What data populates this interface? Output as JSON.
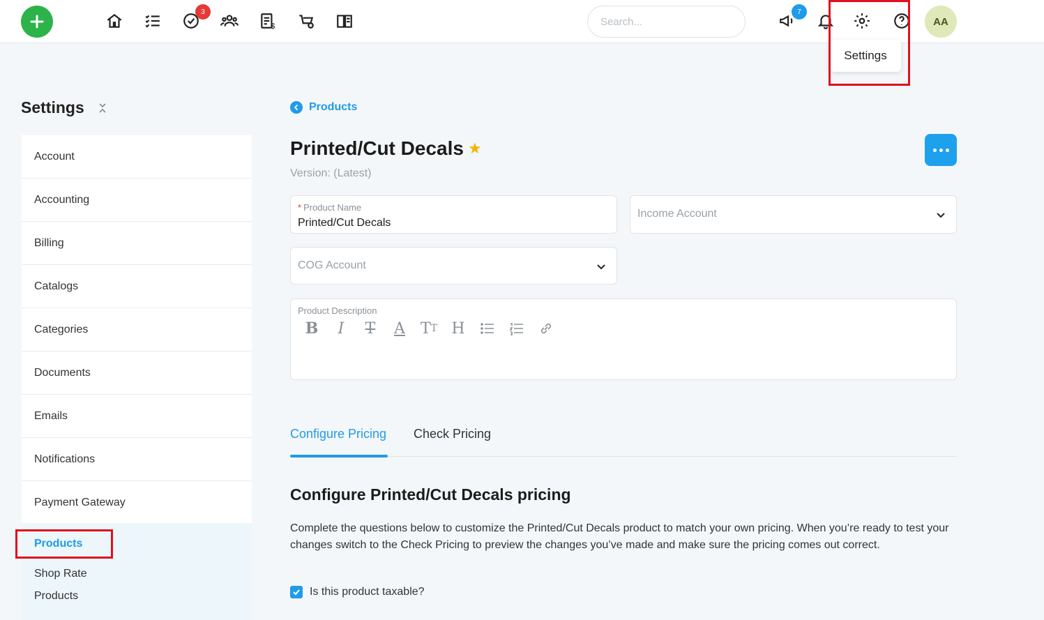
{
  "topbar": {
    "badges": {
      "tasks": "3",
      "announcements": "7"
    },
    "search_placeholder": "Search...",
    "avatar_initials": "AA",
    "tooltip": "Settings"
  },
  "sidebar": {
    "title": "Settings",
    "items": [
      {
        "label": "Account"
      },
      {
        "label": "Accounting"
      },
      {
        "label": "Billing"
      },
      {
        "label": "Catalogs"
      },
      {
        "label": "Categories"
      },
      {
        "label": "Documents"
      },
      {
        "label": "Emails"
      },
      {
        "label": "Notifications"
      },
      {
        "label": "Payment Gateway"
      }
    ],
    "active_section": "Products",
    "sub_items": [
      "Shop Rate",
      "Products"
    ]
  },
  "main": {
    "breadcrumb": "Products",
    "title": "Printed/Cut Decals",
    "version": "Version: (Latest)",
    "fields": {
      "product_name_label": "Product Name",
      "product_name_value": "Printed/Cut Decals",
      "income_account_placeholder": "Income Account",
      "cog_account_placeholder": "COG Account",
      "description_label": "Product Description"
    },
    "tabs": [
      {
        "label": "Configure Pricing"
      },
      {
        "label": "Check Pricing"
      }
    ],
    "section_title": "Configure Printed/Cut Decals pricing",
    "section_desc": "Complete the questions below to customize the Printed/Cut Decals product to match your own pricing. When you’re ready to test your changes switch to the Check Pricing to preview the changes you’ve made and make sure the pricing comes out correct.",
    "taxable_label": "Is this product taxable?"
  },
  "colors": {
    "accent": "#1e9be9",
    "add_button": "#2cb34a",
    "highlight": "#e0101e",
    "star": "#f5b400"
  }
}
